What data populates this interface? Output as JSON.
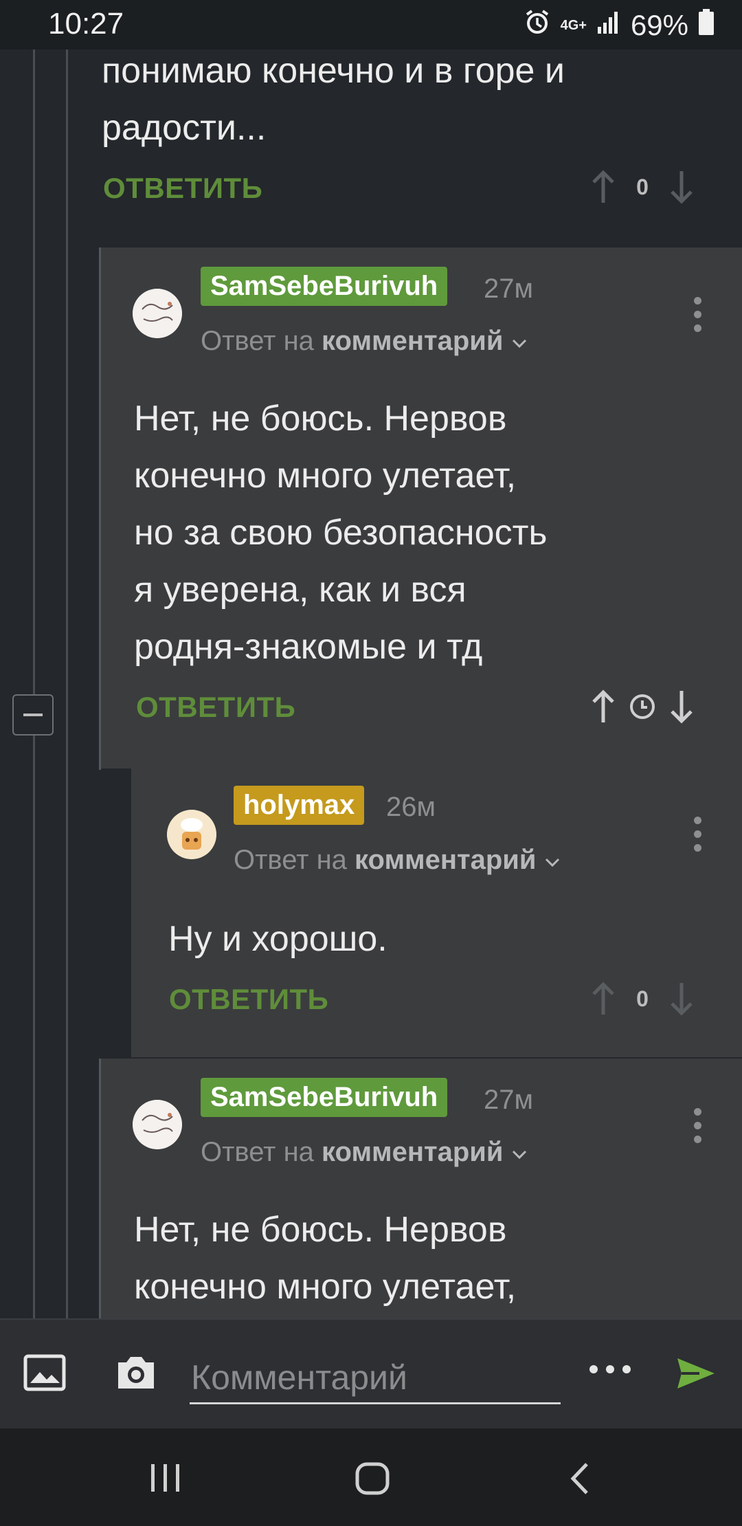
{
  "status_bar": {
    "time": "10:27",
    "network": "4G+",
    "battery": "69%"
  },
  "prev_comment": {
    "text": "понимаю конечно и в горе и\nрадости...",
    "reply_label": "ОТВЕТИТЬ",
    "score": "0"
  },
  "comments": [
    {
      "username": "SamSebeBurivuh",
      "age": "27м",
      "reply_to_prefix": "Ответ на",
      "reply_to_link": "комментарий",
      "text": "Нет, не боюсь. Нервов\nконечно много улетает,\nно за свою безопасность\nя уверена, как и вся\nродня-знакомые и тд",
      "reply_label": "ОТВЕТИТЬ"
    },
    {
      "username": "holymax",
      "age": "26м",
      "reply_to_prefix": "Ответ на",
      "reply_to_link": "комментарий",
      "text": "Ну и хорошо.",
      "reply_label": "ОТВЕТИТЬ",
      "score": "0"
    },
    {
      "username": "SamSebeBurivuh",
      "age": "27м",
      "reply_to_prefix": "Ответ на",
      "reply_to_link": "комментарий",
      "text": "Нет, не боюсь. Нервов\nконечно много улетает,"
    }
  ],
  "input_bar": {
    "placeholder": "Комментарий"
  },
  "colors": {
    "accent_green": "#5f8d3a",
    "badge_green": "#5f9a3c",
    "badge_gold": "#c59a1d",
    "background": "#24272b",
    "card": "#3b3c3e"
  }
}
